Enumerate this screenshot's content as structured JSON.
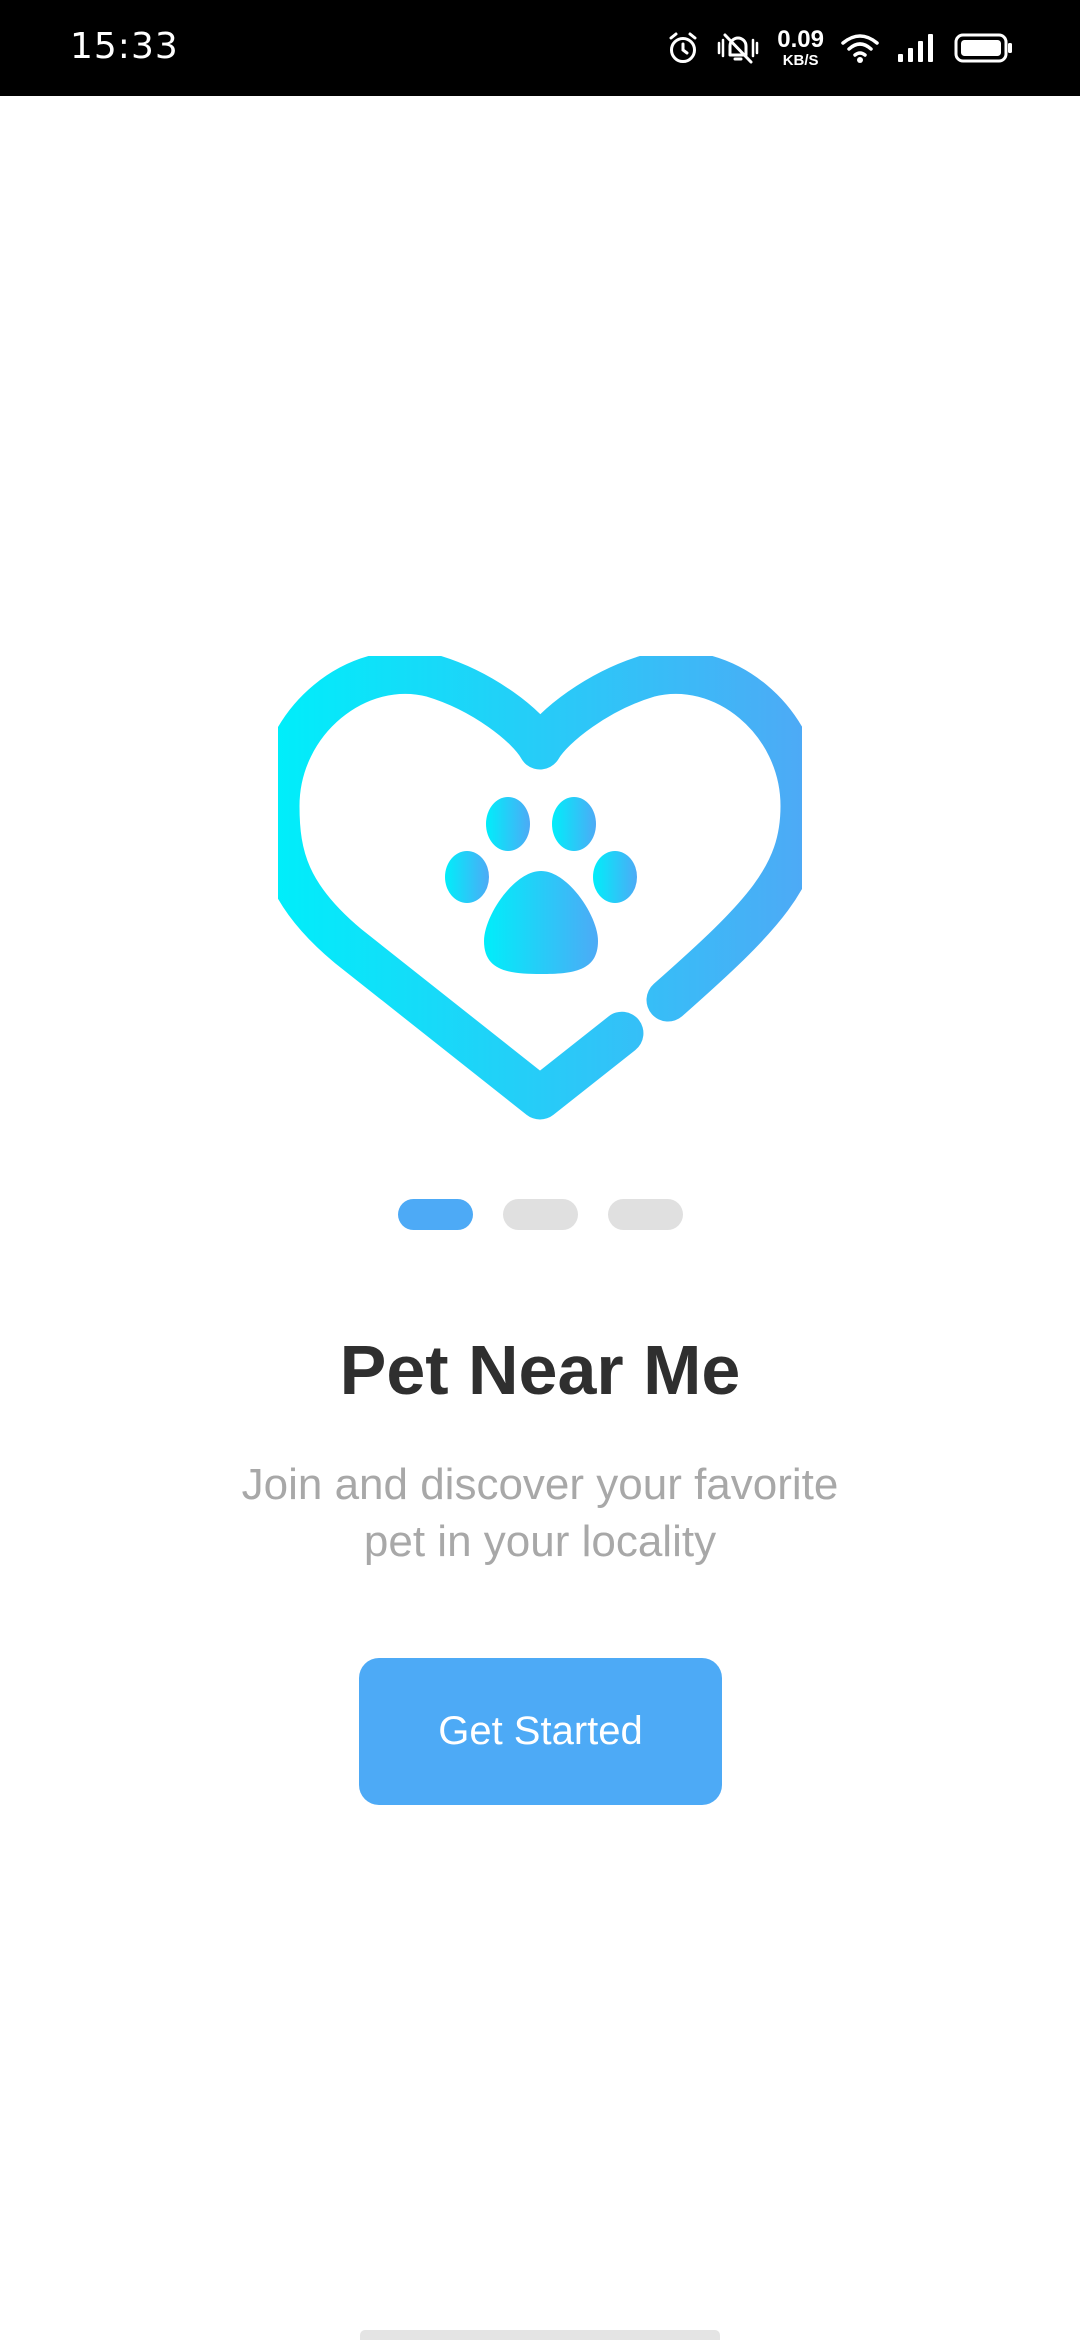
{
  "status_bar": {
    "time": "15:33",
    "net_speed_value": "0.09",
    "net_speed_unit": "KB/S",
    "icons": [
      "alarm-icon",
      "mute-vibrate-icon",
      "wifi-icon",
      "signal-icon",
      "battery-icon"
    ]
  },
  "hero": {
    "icon": "heart-paw-icon",
    "gradient_start": "#00eefa",
    "gradient_end": "#4daaf6"
  },
  "pager": {
    "count": 3,
    "active_index": 0,
    "active_color": "#4daaf6",
    "inactive_color": "#e0e0e0"
  },
  "content": {
    "title": "Pet Near Me",
    "subtitle_line1": "Join and discover your favorite",
    "subtitle_line2": "pet in your locality"
  },
  "cta": {
    "label": "Get Started",
    "color": "#4daaf6"
  }
}
